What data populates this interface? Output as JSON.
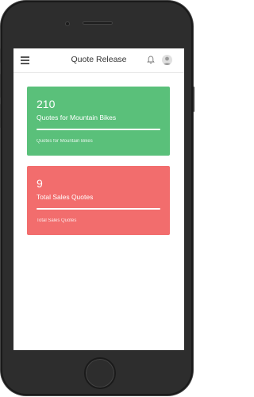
{
  "header": {
    "title": "Quote Release",
    "menu_icon": "hamburger-menu-icon",
    "notification_icon": "bell-icon",
    "avatar_icon": "user-avatar-icon"
  },
  "cards": [
    {
      "value": "210",
      "title": "Quotes for Mountain Bikes",
      "subtitle": "Quotes for Mountain Bikes",
      "color": "#5ac07a",
      "progress": 1.0
    },
    {
      "value": "9",
      "title": "Total Sales Quotes",
      "subtitle": "Total Sales Quotes",
      "color": "#f26d6d",
      "progress": 1.0
    }
  ]
}
